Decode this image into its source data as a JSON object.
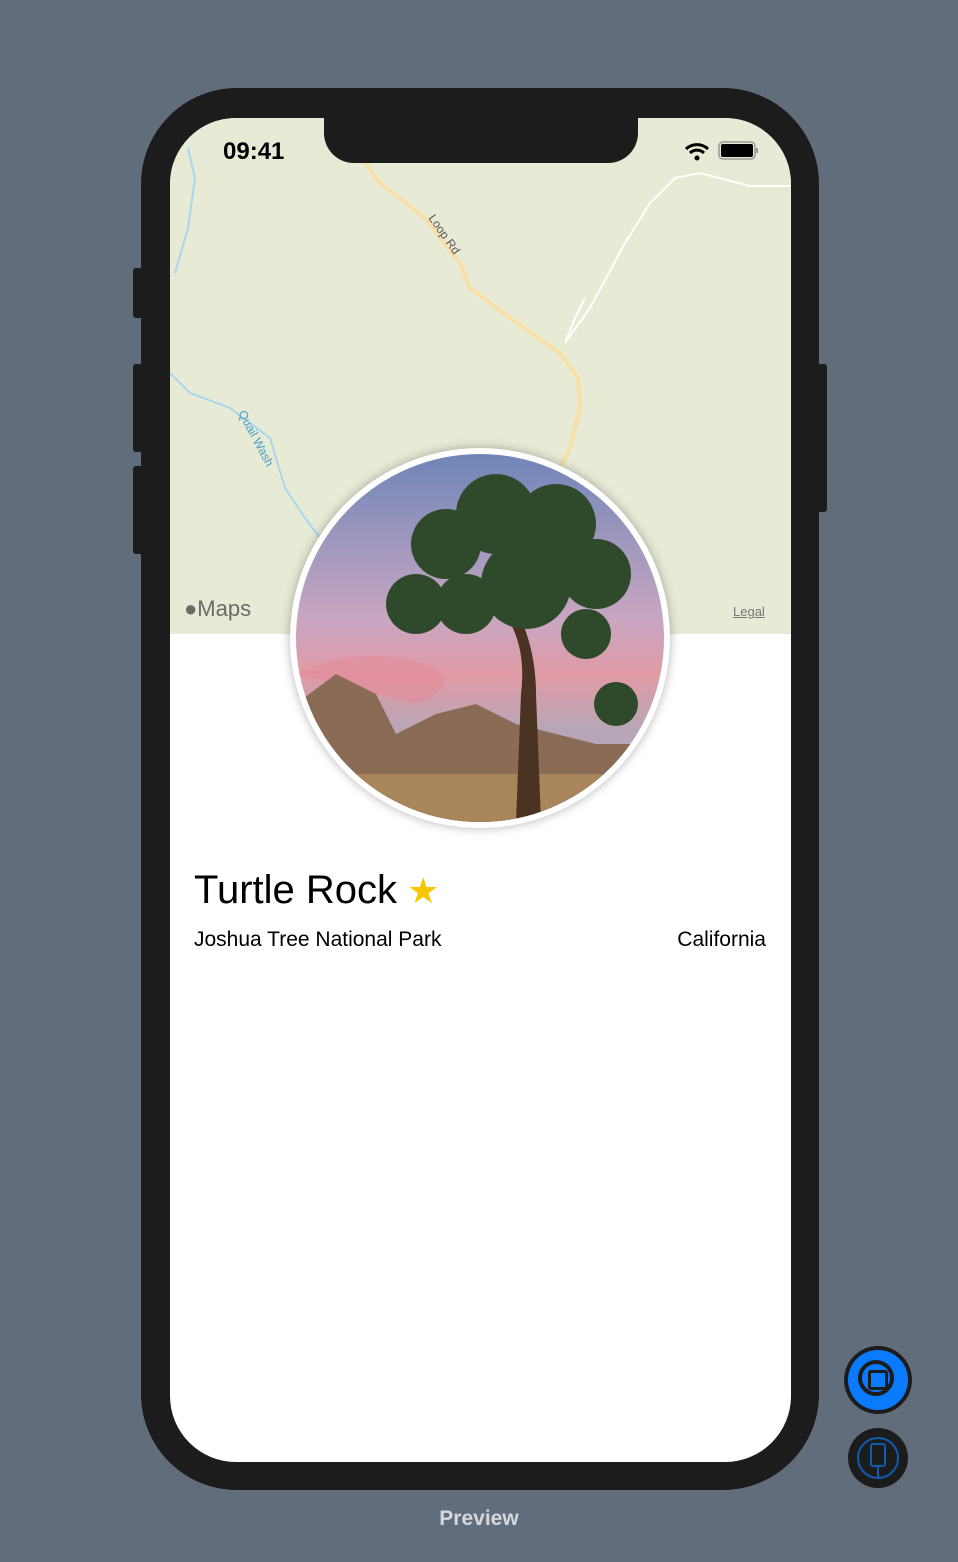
{
  "status_bar": {
    "time": "09:41"
  },
  "map": {
    "attribution": "Maps",
    "legal": "Legal",
    "road_label": "Loop Rd",
    "water_label": "Quail Wash"
  },
  "landmark": {
    "name": "Turtle Rock",
    "favorite_icon": "★",
    "park": "Joshua Tree National Park",
    "state": "California"
  },
  "preview": {
    "label": "Preview"
  },
  "colors": {
    "accent": "#0a7aff",
    "star": "#f7c800",
    "map_bg": "#e7ead5"
  }
}
